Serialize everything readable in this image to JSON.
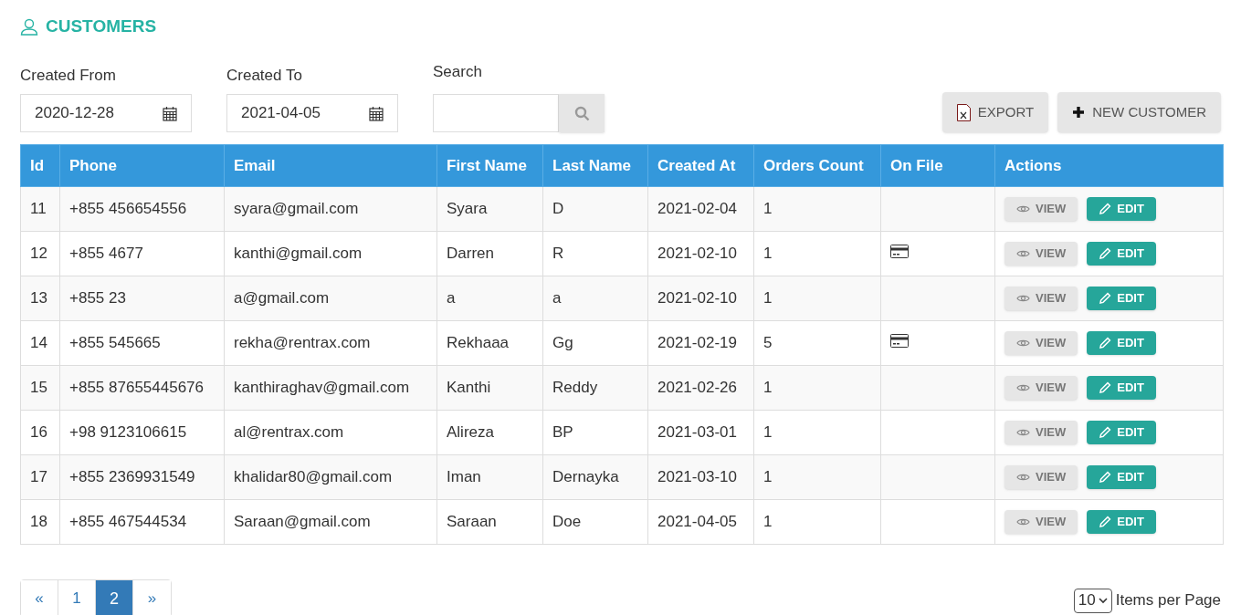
{
  "title": "CUSTOMERS",
  "filters": [
    {
      "label": "Created From",
      "value": "2020-12-28"
    },
    {
      "label": "Created To",
      "value": "2021-04-05"
    }
  ],
  "search": {
    "label": "Search"
  },
  "buttons": [
    {
      "kind": "export",
      "label": "EXPORT"
    },
    {
      "kind": "new",
      "label": "NEW CUSTOMER"
    }
  ],
  "table": {
    "columns": [
      "Id",
      "Phone",
      "Email",
      "First Name",
      "Last Name",
      "Created At",
      "Orders Count",
      "On File",
      "Actions"
    ],
    "rows": [
      {
        "cells": [
          "11",
          "+855 456654556",
          "syara@gmail.com",
          "Syara",
          "D",
          "2021-02-04",
          "1"
        ],
        "card_on_file": false,
        "actions": [
          "VIEW",
          "EDIT"
        ]
      },
      {
        "cells": [
          "12",
          "+855 4677",
          "kanthi@gmail.com",
          "Darren",
          "R",
          "2021-02-10",
          "1"
        ],
        "card_on_file": true,
        "actions": [
          "VIEW",
          "EDIT"
        ]
      },
      {
        "cells": [
          "13",
          "+855 23",
          "a@gmail.com",
          "a",
          "a",
          "2021-02-10",
          "1"
        ],
        "card_on_file": false,
        "actions": [
          "VIEW",
          "EDIT"
        ]
      },
      {
        "cells": [
          "14",
          "+855 545665",
          "rekha@rentrax.com",
          "Rekhaaa",
          "Gg",
          "2021-02-19",
          "5"
        ],
        "card_on_file": true,
        "actions": [
          "VIEW",
          "EDIT"
        ]
      },
      {
        "cells": [
          "15",
          "+855 87655445676",
          "kanthiraghav@gmail.com",
          "Kanthi",
          "Reddy",
          "2021-02-26",
          "1"
        ],
        "card_on_file": false,
        "actions": [
          "VIEW",
          "EDIT"
        ]
      },
      {
        "cells": [
          "16",
          "+98 9123106615",
          "al@rentrax.com",
          "Alireza",
          "BP",
          "2021-03-01",
          "1"
        ],
        "card_on_file": false,
        "actions": [
          "VIEW",
          "EDIT"
        ]
      },
      {
        "cells": [
          "17",
          "+855 2369931549",
          "khalidar80@gmail.com",
          "Iman",
          "Dernayka",
          "2021-03-10",
          "1"
        ],
        "card_on_file": false,
        "actions": [
          "VIEW",
          "EDIT"
        ]
      },
      {
        "cells": [
          "18",
          "+855 467544534",
          "Saraan@gmail.com",
          "Saraan",
          "Doe",
          "2021-04-05",
          "1"
        ],
        "card_on_file": false,
        "actions": [
          "VIEW",
          "EDIT"
        ]
      }
    ]
  },
  "pagination": [
    {
      "label": "«",
      "selected": false
    },
    {
      "label": "1",
      "selected": false
    },
    {
      "label": "2",
      "selected": true
    },
    {
      "label": "»",
      "selected": false
    }
  ],
  "page_size": {
    "value": "10",
    "label": "Items per Page"
  }
}
